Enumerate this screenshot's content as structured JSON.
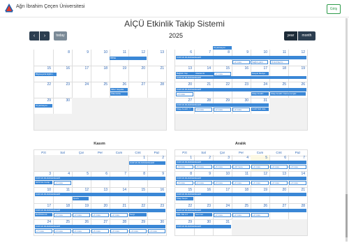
{
  "header": {
    "brand": "Ağrı İbrahim Çeçen Üniversitesi",
    "login_label": "Giriş"
  },
  "page": {
    "title": "AİÇÜ Etkinlik Takip Sistemi"
  },
  "toolbar": {
    "prev_label": "‹",
    "next_label": "›",
    "today_label": "today",
    "year_label": "2025",
    "view_year": "year",
    "view_month": "month"
  },
  "months": {
    "eylul": {
      "weeks": [
        {
          "days": [
            "8",
            "9",
            "10",
            "11",
            "12",
            "13",
            "14"
          ]
        },
        {
          "days": [
            "15",
            "16",
            "17",
            "18",
            "19",
            "20",
            "21"
          ]
        },
        {
          "days": [
            "22",
            "23",
            "24",
            "25",
            "26",
            "27",
            "28"
          ]
        },
        {
          "days": [
            "29",
            "30",
            "",
            "",
            "",
            "",
            ""
          ]
        }
      ],
      "events": {
        "e1": "BBSE",
        "e2": "Bilgisayarla Eğitim",
        "e3": "Siber Hayatta",
        "e4": "Ülkemizde",
        "e5": "Oryantasyon"
      }
    },
    "ekim": {
      "weeks": [
        {
          "days": [
            "6",
            "7",
            "8",
            "9",
            "10",
            "11",
            "12"
          ]
        },
        {
          "days": [
            "13",
            "14",
            "15",
            "16",
            "17",
            "18",
            "19"
          ]
        },
        {
          "days": [
            "20",
            "21",
            "22",
            "23",
            "24",
            "25",
            "26"
          ]
        },
        {
          "days": [
            "27",
            "28",
            "29",
            "30",
            "31",
            "",
            ""
          ]
        }
      ],
      "events": {
        "top": "Oryantasyon",
        "k1": "KUR'AN MUZAKERELERİ",
        "k1m1": "+2 more",
        "k1m2": "Sağlık günü",
        "k1m3": "Ünirehberim",
        "k2": "KUR'AN MUZAKERELERİ",
        "k2a": "Bağlılık Yap",
        "k2b": "Akademik",
        "k2c": "+2 more",
        "k2d": "Sosyal Medya",
        "k3": "KUR'AN MUZAKERELERİ",
        "k3m1": "+2 more",
        "k3a": "Kitap Analizi",
        "k3b": "Kitap Analizi: Karma sergisi",
        "k4": "KUR'AN MUZAKERELERİ",
        "k4a": "Kitap Analizi: Y",
        "k4m1": "+3 more",
        "k4m2": "+2 more",
        "k4m3": "+2 more",
        "k4b": "KARİYER GEL"
      }
    },
    "kasim": {
      "title": "Kasım",
      "dow": [
        "Pzt",
        "Sal",
        "Çar",
        "Per",
        "Cum",
        "Cmt",
        "Paz"
      ],
      "weeks": [
        {
          "days": [
            "",
            "",
            "",
            "",
            "",
            "1",
            "2"
          ]
        },
        {
          "days": [
            "3",
            "4",
            "5",
            "6",
            "7",
            "8",
            "9"
          ]
        },
        {
          "days": [
            "10",
            "11",
            "12",
            "13",
            "14",
            "15",
            "16"
          ]
        },
        {
          "days": [
            "17",
            "18",
            "19",
            "20",
            "21",
            "22",
            "23"
          ]
        },
        {
          "days": [
            "24",
            "25",
            "26",
            "27",
            "28",
            "29",
            "30"
          ]
        }
      ],
      "events": {
        "w1": "KUR'AN MUZAKERELERİ",
        "w2": "KUR'AN MUZAKERELERİ",
        "w2a": "SOSYAL Kulüp",
        "w2m": "+2 more",
        "w3": "KUR'AN MUZAKERELERİ",
        "w3a": "Çevre",
        "w4": "KUR'AN MUZAKERELERİ",
        "w4a": "BAĞIMLILIK",
        "w4m1": "+2 more",
        "w4m2": "+2 more",
        "w4m3": "+4 more",
        "w4m4": "+2 more",
        "w4b": "Sergi",
        "w5": "KUR'AN MUZAKERELERİ",
        "w5m": [
          "+7 more",
          "+3 more",
          "+4 more",
          "+6 more",
          "+3 more",
          "+3 more",
          "+3 more"
        ]
      }
    },
    "aralik": {
      "title": "Aralık",
      "dow": [
        "Pzt",
        "Sal",
        "Çar",
        "Per",
        "Cum",
        "Cmt",
        "Paz"
      ],
      "weeks": [
        {
          "days": [
            "1",
            "2",
            "3",
            "4",
            "5",
            "6",
            "7"
          ]
        },
        {
          "days": [
            "8",
            "9",
            "10",
            "11",
            "12",
            "13",
            "14"
          ]
        },
        {
          "days": [
            "15",
            "16",
            "17",
            "18",
            "19",
            "20",
            "21"
          ]
        },
        {
          "days": [
            "22",
            "23",
            "24",
            "25",
            "26",
            "27",
            "28"
          ]
        },
        {
          "days": [
            "29",
            "30",
            "31",
            "",
            "",
            "",
            ""
          ]
        }
      ],
      "events": {
        "w1": "KUR'AN MUZAKERELERİ",
        "w1m": [
          "+6 more",
          "+6 more",
          "+6 more",
          "+10 more",
          "+4 more",
          "+2 more",
          "+3 more"
        ],
        "w2": "KUR'AN MUZAKERELERİ",
        "w2m": [
          "+5 more",
          "+4 more",
          "+3 more",
          "+3 more",
          "+4 more",
          "+2 more",
          "+2 more"
        ],
        "w3": "KUR'AN MUZAKERELERİ",
        "w3a": "Kitap Seçim",
        "w4": "KUR'AN MUZAKERELERİ",
        "w4a": "ÖBL DE 4 P",
        "w4b": "Seminer",
        "w4m1": "+2 more",
        "w4m2": "+2 more",
        "w4m3": "+2 more",
        "w5": "KUR'AN MUZAKERELERİ"
      }
    }
  },
  "colors": {
    "event": "#3a87d6",
    "toolbar_dark": "#2c3e50",
    "login": "#2e9b4a",
    "day_number": "#2c65b5"
  }
}
